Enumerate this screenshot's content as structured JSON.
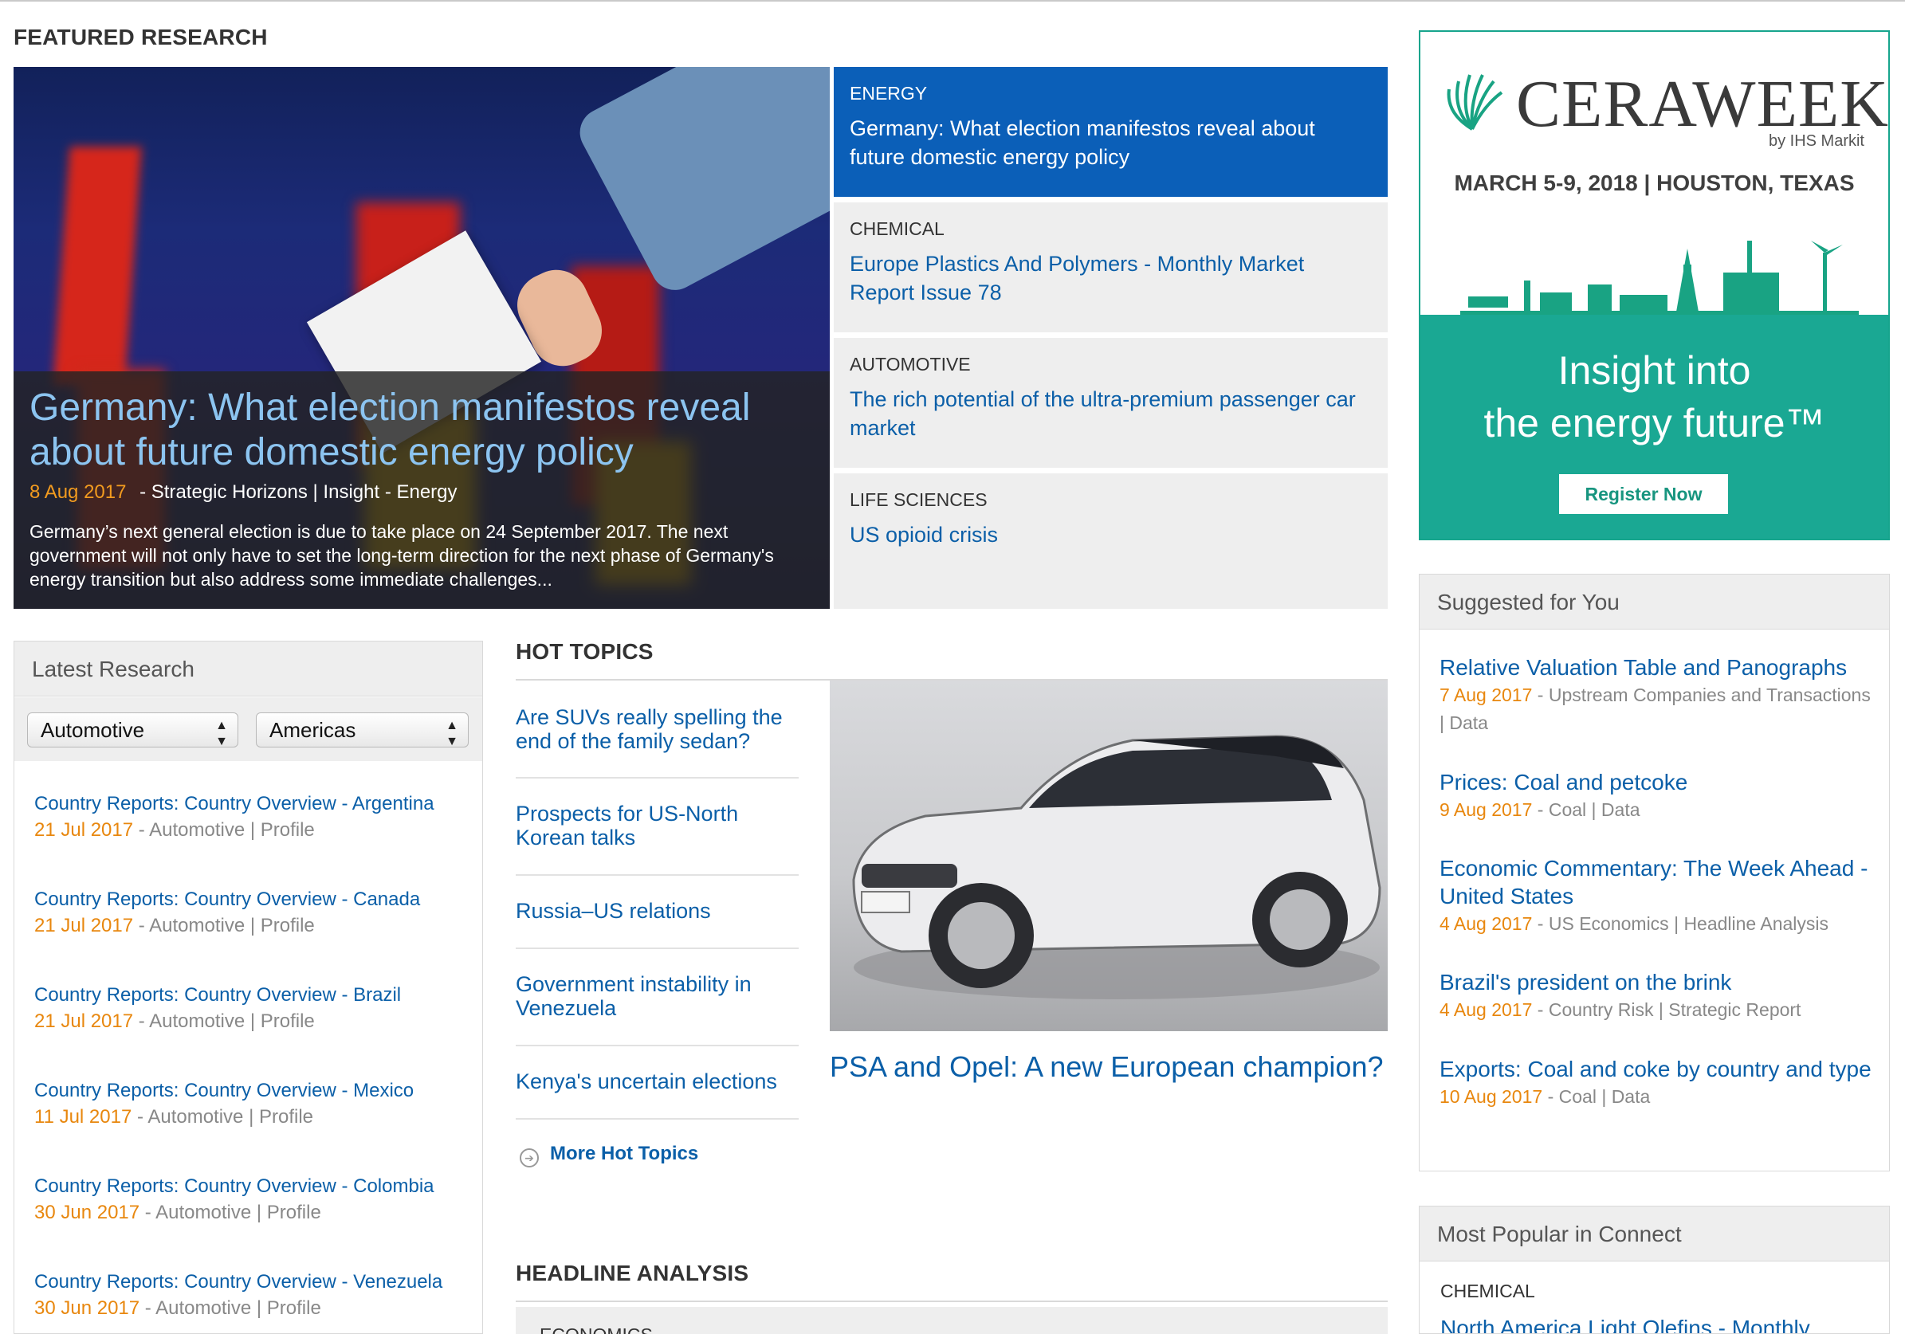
{
  "featured": {
    "heading": "FEATURED RESEARCH",
    "hero": {
      "title": "Germany: What election manifestos reveal about future domestic energy policy",
      "date": "8 Aug 2017",
      "meta": "- Strategic Horizons | Insight - Energy",
      "summary": "Germany’s next general election is due to take place on 24 September 2017. The next government will not only have to set the long-term direction for the next phase of Germany's energy transition but also address some immediate challenges..."
    },
    "items": [
      {
        "category": "ENERGY",
        "title": "Germany: What election manifestos reveal about future domestic energy policy"
      },
      {
        "category": "CHEMICAL",
        "title": "Europe Plastics And Polymers - Monthly Market Report Issue 78"
      },
      {
        "category": "AUTOMOTIVE",
        "title": "The rich potential of the ultra-premium passenger car market"
      },
      {
        "category": "LIFE SCIENCES",
        "title": "US opioid crisis"
      }
    ]
  },
  "ad": {
    "brand": "CERAWEEK",
    "by": "by IHS Markit",
    "date": "MARCH 5-9, 2018 | HOUSTON, TEXAS",
    "tagline1": "Insight into",
    "tagline2": "the energy future™",
    "cta": "Register Now"
  },
  "latest": {
    "heading": "Latest Research",
    "filter1": "Automotive",
    "filter2": "Americas",
    "items": [
      {
        "title": "Country Reports: Country Overview - Argentina",
        "date": "21 Jul 2017",
        "meta": "Automotive | Profile"
      },
      {
        "title": "Country Reports: Country Overview - Canada",
        "date": "21 Jul 2017",
        "meta": "Automotive | Profile"
      },
      {
        "title": "Country Reports: Country Overview - Brazil",
        "date": "21 Jul 2017",
        "meta": "Automotive | Profile"
      },
      {
        "title": "Country Reports: Country Overview - Mexico",
        "date": "11 Jul 2017",
        "meta": "Automotive | Profile"
      },
      {
        "title": "Country Reports: Country Overview - Colombia",
        "date": "30 Jun 2017",
        "meta": "Automotive | Profile"
      },
      {
        "title": "Country Reports: Country Overview - Venezuela",
        "date": "30 Jun 2017",
        "meta": "Automotive | Profile"
      }
    ]
  },
  "hot_topics": {
    "heading": "HOT TOPICS",
    "items": [
      "Are SUVs really spelling the end of the family sedan?",
      "Prospects for US-North Korean talks",
      "Russia–US relations",
      "Government instability in Venezuela",
      "Kenya's uncertain elections"
    ],
    "more": "More Hot Topics",
    "feature_caption": "PSA and Opel: A new European champion?"
  },
  "headline": {
    "heading": "HEADLINE ANALYSIS",
    "first_category": "ECONOMICS"
  },
  "suggested": {
    "heading": "Suggested for You",
    "items": [
      {
        "title": "Relative Valuation Table and Panographs",
        "date": "7 Aug 2017",
        "meta": "Upstream Companies and Transactions | Data"
      },
      {
        "title": "Prices: Coal and petcoke",
        "date": "9 Aug 2017",
        "meta": "Coal | Data"
      },
      {
        "title": "Economic Commentary: The Week Ahead - United States",
        "date": "4 Aug 2017",
        "meta": "US Economics | Headline Analysis"
      },
      {
        "title": "Brazil's president on the brink",
        "date": "4 Aug 2017",
        "meta": "Country Risk | Strategic Report"
      },
      {
        "title": "Exports: Coal and coke by country and type",
        "date": "10 Aug 2017",
        "meta": "Coal | Data"
      }
    ]
  },
  "popular": {
    "heading": "Most Popular in Connect",
    "category": "CHEMICAL",
    "first_title": "North America Light Olefins - Monthly"
  }
}
